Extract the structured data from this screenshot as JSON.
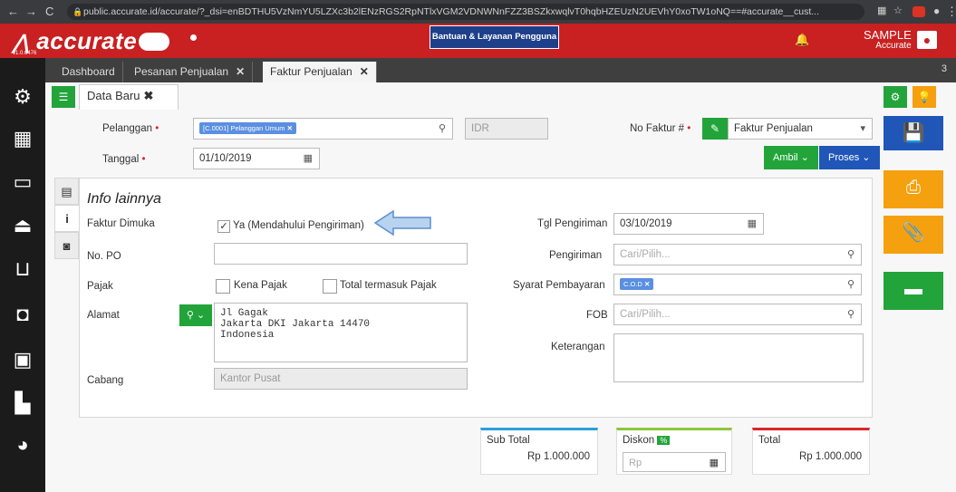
{
  "browser": {
    "url": "public.accurate.id/accurate/?_dsi=enBDTHU5VzNmYU5LZXc3b2lENzRGS2RpNTlxVGM2VDNWNnFZZ3BSZkxwqlvT0hqbHZEUzN2UEVhY0xoTW1oNQ==#accurate__cust...",
    "back_icon": "back-arrow-icon",
    "forward_icon": "forward-arrow-icon",
    "reload_icon": "reload-icon"
  },
  "app": {
    "logo_text": "accurate",
    "logo_sub": "online",
    "version": "v1.0.6476",
    "help_label": "Bantuan & Layanan Pengguna",
    "user_name": "SAMPLE",
    "user_company": "Accurate"
  },
  "tabs": [
    {
      "label": "Dashboard",
      "closable": false
    },
    {
      "label": "Pesanan Penjualan",
      "closable": true
    },
    {
      "label": "Faktur Penjualan",
      "closable": true
    }
  ],
  "tab_count": "3",
  "subtab": {
    "label": "Data Baru"
  },
  "form": {
    "pelanggan_label": "Pelanggan",
    "pelanggan_value": "[C.0001] Pelanggan Umum",
    "currency": "IDR",
    "tanggal_label": "Tanggal",
    "tanggal_value": "01/10/2019",
    "nofaktur_label": "No Faktur #",
    "nofaktur_value": "Faktur Penjualan",
    "ambil_label": "Ambil",
    "proses_label": "Proses",
    "required_mark": "•"
  },
  "info": {
    "title": "Info lainnya",
    "faktur_dimuka_label": "Faktur Dimuka",
    "faktur_dimuka_checkbox": "Ya (Mendahului Pengiriman)",
    "faktur_dimuka_checked": true,
    "nopo_label": "No. PO",
    "nopo_value": "",
    "pajak_label": "Pajak",
    "kena_pajak_label": "Kena Pajak",
    "total_pajak_label": "Total termasuk Pajak",
    "alamat_label": "Alamat",
    "alamat_lines": [
      "Jl Gagak",
      "Jakarta DKI Jakarta 14470",
      "Indonesia"
    ],
    "cabang_label": "Cabang",
    "cabang_value": "Kantor Pusat",
    "tgl_pengiriman_label": "Tgl Pengiriman",
    "tgl_pengiriman_value": "03/10/2019",
    "pengiriman_label": "Pengiriman",
    "pengiriman_placeholder": "Cari/Pilih...",
    "syarat_label": "Syarat Pembayaran",
    "syarat_value": "C.O.D",
    "fob_label": "FOB",
    "fob_placeholder": "Cari/Pilih...",
    "keterangan_label": "Keterangan",
    "keterangan_value": ""
  },
  "totals": {
    "subtotal_label": "Sub Total",
    "subtotal_value": "Rp 1.000.000",
    "diskon_label": "Diskon",
    "diskon_badge": "%",
    "diskon_placeholder": "Rp",
    "total_label": "Total",
    "total_value": "Rp 1.000.000"
  },
  "colors": {
    "brand_red": "#c92021",
    "green": "#22a43a",
    "blue": "#2056b8",
    "orange": "#f5a00f",
    "sidebar": "#1b1b1b"
  }
}
